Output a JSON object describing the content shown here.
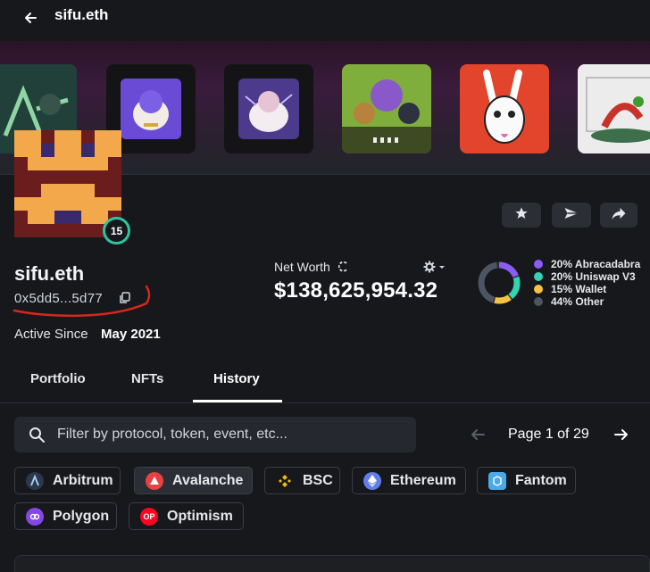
{
  "header": {
    "title": "sifu.eth"
  },
  "icons": {
    "back": "arrow-left-icon",
    "star": "star-icon",
    "send": "send-icon",
    "share": "share-icon",
    "copy": "copy-icon",
    "gear": "gear-icon",
    "search": "search-icon"
  },
  "profile": {
    "name": "sifu.eth",
    "address": "0x5dd5...5d77",
    "level": "15",
    "active_since_label": "Active Since",
    "active_since_value": "May 2021"
  },
  "net_worth": {
    "label": "Net Worth",
    "value": "$138,625,954.32"
  },
  "allocation": [
    {
      "label": "20% Abracadabra",
      "color": "#8b5cf6",
      "fraction": 0.2
    },
    {
      "label": "20% Uniswap V3",
      "color": "#34d3b4",
      "fraction": 0.2
    },
    {
      "label": "15% Wallet",
      "color": "#f6c343",
      "fraction": 0.15
    },
    {
      "label": "44% Other",
      "color": "#4b5563",
      "fraction": 0.44
    }
  ],
  "tabs": [
    {
      "label": "Portfolio"
    },
    {
      "label": "NFTs"
    },
    {
      "label": "History",
      "active": true
    }
  ],
  "search": {
    "placeholder": "Filter by protocol, token, event, etc..."
  },
  "pagination": {
    "label": "Page 1 of 29"
  },
  "chains": [
    {
      "label": "Arbitrum",
      "icon": "arbitrum-icon",
      "color": "#2d374b"
    },
    {
      "label": "Avalanche",
      "icon": "avalanche-icon",
      "color": "#e84142",
      "selected": true
    },
    {
      "label": "BSC",
      "icon": "bsc-icon",
      "color": "#f0b90b"
    },
    {
      "label": "Ethereum",
      "icon": "ethereum-icon",
      "color": "#627eea"
    },
    {
      "label": "Fantom",
      "icon": "fantom-icon",
      "color": "#4aa9e8"
    },
    {
      "label": "Polygon",
      "icon": "polygon-icon",
      "color": "#8247e5"
    },
    {
      "label": "Optimism",
      "icon": "optimism-icon",
      "color": "#ff0420",
      "badge": "OP"
    }
  ]
}
